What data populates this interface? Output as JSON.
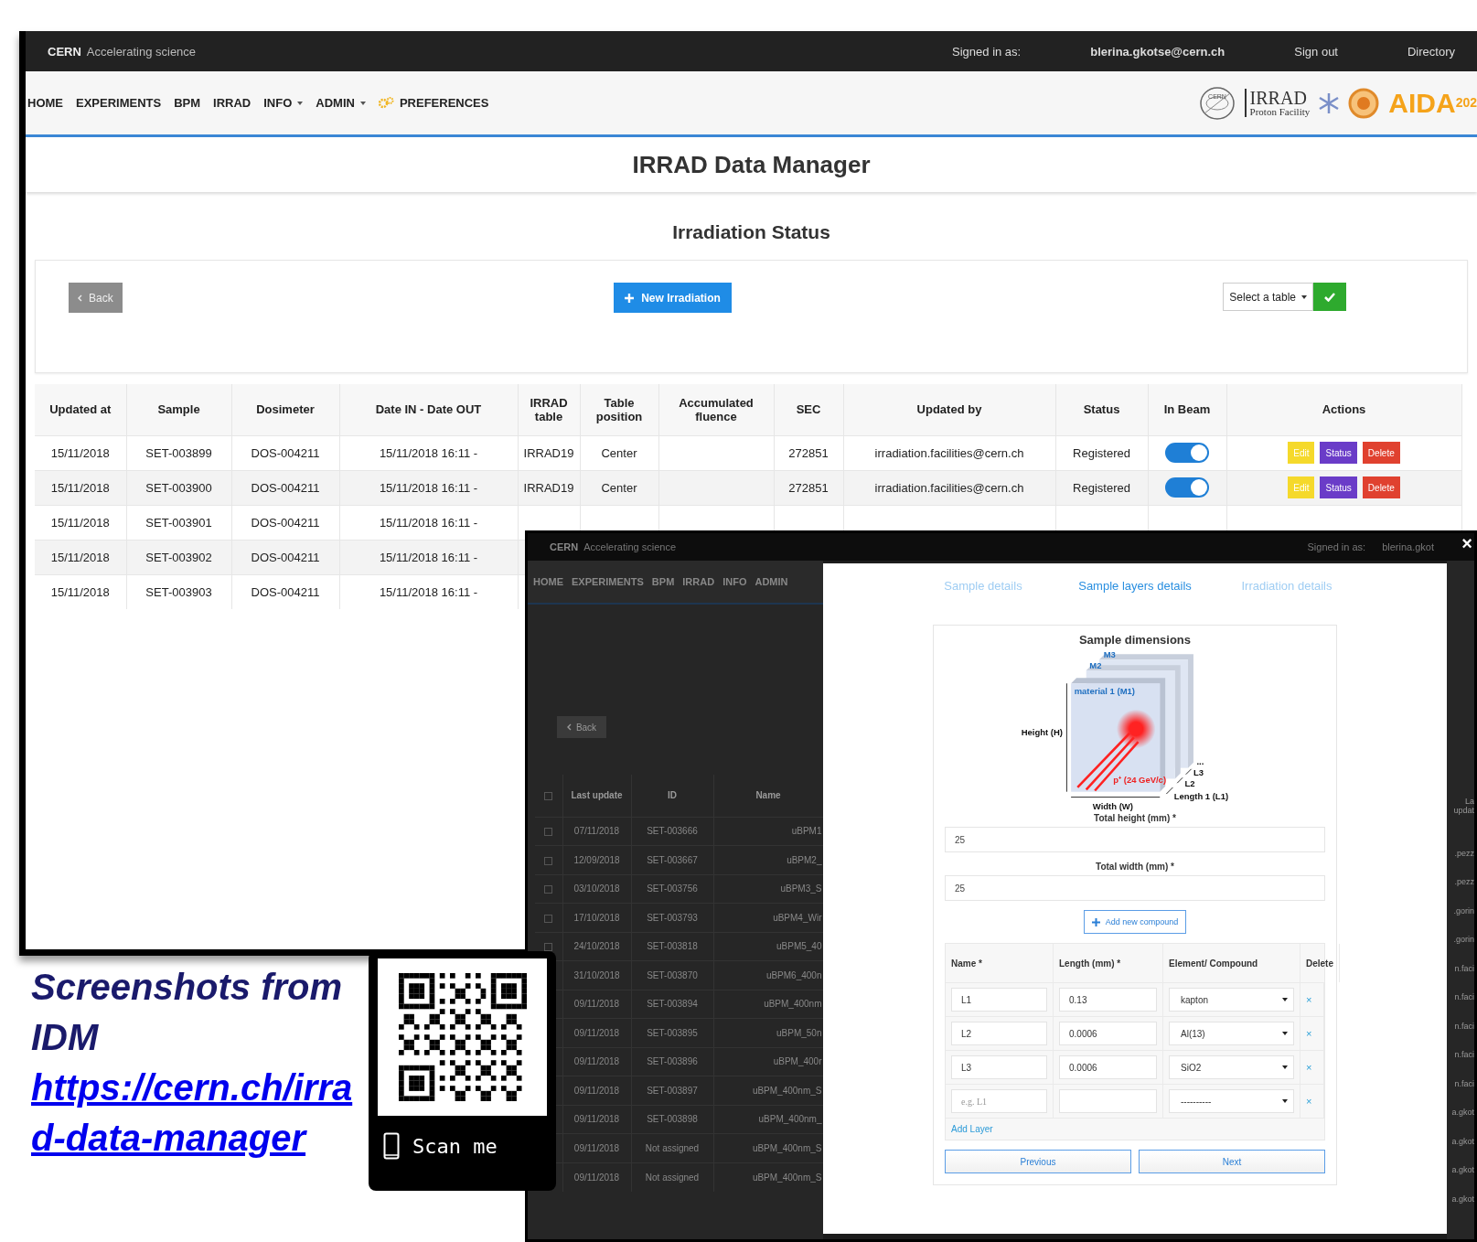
{
  "main_window": {
    "topbar": {
      "brand": "CERN",
      "tagline": "Accelerating science",
      "signed_in_label": "Signed in as:",
      "user": "blerina.gkotse@cern.ch",
      "sign_out": "Sign out",
      "directory": "Directory"
    },
    "nav": [
      {
        "label": "HOME",
        "dropdown": false,
        "kind": "link"
      },
      {
        "label": "EXPERIMENTS",
        "dropdown": false,
        "kind": "link"
      },
      {
        "label": "BPM",
        "dropdown": false,
        "kind": "link"
      },
      {
        "label": "IRRAD",
        "dropdown": false,
        "kind": "link"
      },
      {
        "label": "INFO",
        "dropdown": true,
        "kind": "link"
      },
      {
        "label": "ADMIN",
        "dropdown": true,
        "kind": "link"
      },
      {
        "label": "PREFERENCES",
        "dropdown": false,
        "kind": "gear-link"
      }
    ],
    "logos": {
      "cern": "CERN",
      "irrad": "IRRAD",
      "irrad_sub": "Proton Facility",
      "aida": "AIDA",
      "aida_sup": "202"
    },
    "title": "IRRAD Data Manager",
    "section_title": "Irradiation Status",
    "toolbar": {
      "back": "Back",
      "new": "New Irradiation",
      "select": "Select a table"
    },
    "table": {
      "columns": [
        "Updated at",
        "Sample",
        "Dosimeter",
        "Date IN - Date OUT",
        "IRRAD table",
        "Table position",
        "Accumulated fluence",
        "SEC",
        "Updated by",
        "Status",
        "In Beam",
        "Actions"
      ],
      "rows": [
        {
          "cells": [
            "15/11/2018",
            "SET-003899",
            "DOS-004211",
            "15/11/2018 16:11 -",
            "IRRAD19",
            "Center",
            "",
            "272851",
            "irradiation.facilities@cern.ch",
            "Registered"
          ],
          "in_beam": true,
          "actions": [
            "Edit",
            "Status",
            "Delete"
          ]
        },
        {
          "cells": [
            "15/11/2018",
            "SET-003900",
            "DOS-004211",
            "15/11/2018 16:11 -",
            "IRRAD19",
            "Center",
            "",
            "272851",
            "irradiation.facilities@cern.ch",
            "Registered"
          ],
          "in_beam": true,
          "actions": [
            "Edit",
            "Status",
            "Delete"
          ]
        },
        {
          "cells": [
            "15/11/2018",
            "SET-003901",
            "DOS-004211",
            "15/11/2018 16:11 -"
          ]
        },
        {
          "cells": [
            "15/11/2018",
            "SET-003902",
            "DOS-004211",
            "15/11/2018 16:11 -"
          ]
        },
        {
          "cells": [
            "15/11/2018",
            "SET-003903",
            "DOS-004211",
            "15/11/2018 16:11 -"
          ]
        }
      ]
    }
  },
  "overlay_window": {
    "topbar": {
      "brand": "CERN",
      "tagline": "Accelerating science",
      "signed_in_label": "Signed in as:",
      "user": "blerina.gkot"
    },
    "nav": [
      "HOME",
      "EXPERIMENTS",
      "BPM",
      "IRRAD",
      "INFO",
      "ADMIN"
    ],
    "back": "Back",
    "table": {
      "columns": [
        "Last update",
        "ID",
        "Name"
      ],
      "select_all_checked": false,
      "rows": [
        {
          "checked": false,
          "cells": [
            "07/11/2018",
            "SET-003666",
            "uBPM1"
          ]
        },
        {
          "checked": false,
          "cells": [
            "12/09/2018",
            "SET-003667",
            "uBPM2_"
          ]
        },
        {
          "checked": false,
          "cells": [
            "03/10/2018",
            "SET-003756",
            "uBPM3_S"
          ]
        },
        {
          "checked": false,
          "cells": [
            "17/10/2018",
            "SET-003793",
            "uBPM4_Wir"
          ]
        },
        {
          "checked": false,
          "cells": [
            "24/10/2018",
            "SET-003818",
            "uBPM5_40"
          ]
        },
        {
          "cells": [
            "31/10/2018",
            "SET-003870",
            "uBPM6_400n"
          ]
        },
        {
          "cells": [
            "09/11/2018",
            "SET-003894",
            "uBPM_400nm"
          ]
        },
        {
          "cells": [
            "09/11/2018",
            "SET-003895",
            "uBPM_50n"
          ]
        },
        {
          "cells": [
            "09/11/2018",
            "SET-003896",
            "uBPM_400r"
          ]
        },
        {
          "cells": [
            "09/11/2018",
            "SET-003897",
            "uBPM_400nm_S"
          ]
        },
        {
          "cells": [
            "09/11/2018",
            "SET-003898",
            "uBPM_400nm_"
          ]
        },
        {
          "cells": [
            "09/11/2018",
            "Not assigned",
            "uBPM_400nm_S"
          ]
        },
        {
          "cells": [
            "09/11/2018",
            "Not assigned",
            "uBPM_400nm_S"
          ]
        }
      ]
    },
    "right_column": {
      "header": "La updat",
      "cells": [
        ".pezz",
        ".pezz",
        ".gorin",
        ".gorin",
        "n.faci",
        "n.faci",
        "n.faci",
        "n.faci",
        "n.faci",
        "a.gkot",
        "a.gkot",
        "a.gkot",
        "a.gkot"
      ]
    }
  },
  "modal": {
    "tabs": [
      {
        "label": "Sample details",
        "selected": false
      },
      {
        "label": "Sample layers details",
        "selected": true
      },
      {
        "label": "Irradiation details",
        "selected": false
      }
    ],
    "card_title": "Sample dimensions",
    "diagram": {
      "m1": "material 1 (M1)",
      "m2": "M2",
      "m3": "M3",
      "height": "Height (H)",
      "width": "Width (W)",
      "l1": "Length 1 (L1)",
      "l2": "L2",
      "l3": "L3",
      "more": "...",
      "beam": "p⁺ (24 GeV/c)"
    },
    "fields": [
      {
        "label": "Total height (mm) *",
        "value": "25"
      },
      {
        "label": "Total width (mm) *",
        "value": "25"
      }
    ],
    "add_compound": "Add new compound",
    "layers": {
      "columns": [
        "Name *",
        "Length (mm) *",
        "Element/ Compound",
        "Delete"
      ],
      "rows": [
        {
          "name": "L1",
          "length": "0.13",
          "compound": "kapton"
        },
        {
          "name": "L2",
          "length": "0.0006",
          "compound": "Al(13)"
        },
        {
          "name": "L3",
          "length": "0.0006",
          "compound": "SiO2"
        },
        {
          "placeholder": "e.g. L1",
          "compound": "----------"
        }
      ],
      "delete": "×",
      "add_layer": "Add Layer"
    },
    "buttons": [
      "Previous",
      "Next"
    ]
  },
  "close": "×",
  "qr": {
    "label": "Scan me"
  },
  "caption": {
    "title": "Screenshots from IDM",
    "link": "https://cern.ch/irrad-data-manager"
  }
}
